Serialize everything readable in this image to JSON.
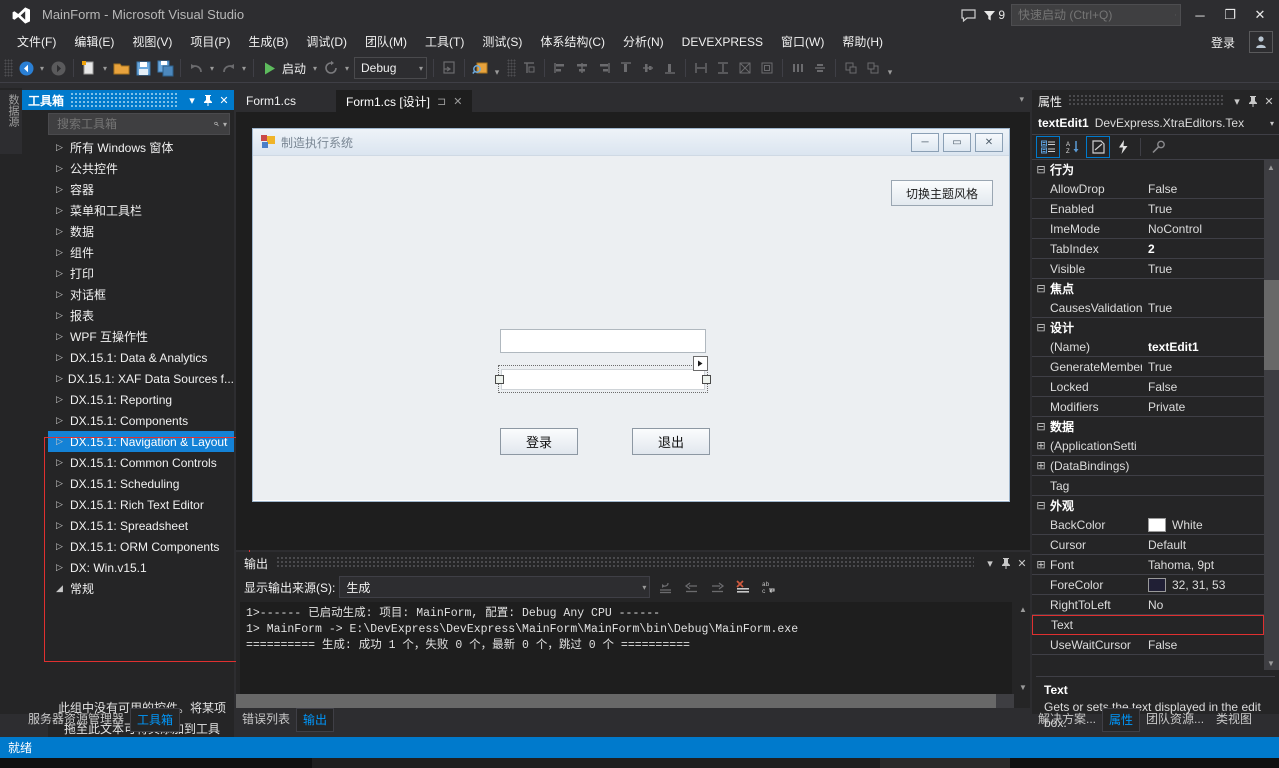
{
  "titlebar": {
    "title": "MainForm - Microsoft Visual Studio",
    "notification_count": "9",
    "quick_launch_placeholder": "快速启动 (Ctrl+Q)",
    "minimize": "─",
    "restore": "❐",
    "close": "✕"
  },
  "menubar": {
    "items": [
      {
        "label": "文件(F)"
      },
      {
        "label": "编辑(E)"
      },
      {
        "label": "视图(V)"
      },
      {
        "label": "项目(P)"
      },
      {
        "label": "生成(B)"
      },
      {
        "label": "调试(D)"
      },
      {
        "label": "团队(M)"
      },
      {
        "label": "工具(T)"
      },
      {
        "label": "测试(S)"
      },
      {
        "label": "体系结构(C)"
      },
      {
        "label": "分析(N)"
      },
      {
        "label": "DEVEXPRESS"
      },
      {
        "label": "窗口(W)"
      },
      {
        "label": "帮助(H)"
      }
    ],
    "signin": "登录"
  },
  "toolbar": {
    "start_label": "启动",
    "configuration": "Debug",
    "overflow": "▾"
  },
  "leftstrip": {
    "vertical_tab": "数据源"
  },
  "toolbox": {
    "title": "工具箱",
    "search_placeholder": "搜索工具箱",
    "items": [
      {
        "label": "所有 Windows 窗体",
        "selected": false
      },
      {
        "label": "公共控件",
        "selected": false
      },
      {
        "label": "容器",
        "selected": false
      },
      {
        "label": "菜单和工具栏",
        "selected": false
      },
      {
        "label": "数据",
        "selected": false
      },
      {
        "label": "组件",
        "selected": false
      },
      {
        "label": "打印",
        "selected": false
      },
      {
        "label": "对话框",
        "selected": false
      },
      {
        "label": "报表",
        "selected": false
      },
      {
        "label": "WPF 互操作性",
        "selected": false
      },
      {
        "label": "DX.15.1: Data & Analytics",
        "selected": false
      },
      {
        "label": "DX.15.1: XAF Data Sources f...",
        "selected": false
      },
      {
        "label": "DX.15.1: Reporting",
        "selected": false
      },
      {
        "label": "DX.15.1: Components",
        "selected": false
      },
      {
        "label": "DX.15.1: Navigation & Layout",
        "selected": true
      },
      {
        "label": "DX.15.1: Common Controls",
        "selected": false
      },
      {
        "label": "DX.15.1: Scheduling",
        "selected": false
      },
      {
        "label": "DX.15.1: Rich Text Editor",
        "selected": false
      },
      {
        "label": "DX.15.1: Spreadsheet",
        "selected": false
      },
      {
        "label": "DX.15.1: ORM Components",
        "selected": false
      },
      {
        "label": "DX: Win.v15.1",
        "selected": false
      },
      {
        "label": "常规",
        "selected": false,
        "expanded": true
      }
    ],
    "empty_note": "此组中没有可用的控件。将某项拖至此文本可将其添加到工具箱。",
    "bottom_tabs": [
      {
        "label": "服务器资源管理器",
        "active": false
      },
      {
        "label": "工具箱",
        "active": true
      }
    ],
    "highlight_color": "#e03030"
  },
  "document_tabs": [
    {
      "label": "Form1.cs",
      "active": false
    },
    {
      "label": "Form1.cs [设计]",
      "active": true
    }
  ],
  "designer": {
    "form_title": "制造执行系统",
    "window_buttons": {
      "minimize": "─",
      "maximize": "▭",
      "close": "✕"
    },
    "theme_button": "切换主题风格",
    "buttons": [
      {
        "label": "登录"
      },
      {
        "label": "退出"
      }
    ],
    "textbox_values": [
      "",
      ""
    ]
  },
  "output": {
    "title": "输出",
    "source_label": "显示输出来源(S):",
    "source_value": "生成",
    "lines": [
      "1>------ 已启动生成:  项目: MainForm, 配置: Debug Any CPU ------",
      "1>  MainForm -> E:\\DevExpress\\DevExpress\\MainForm\\MainForm\\bin\\Debug\\MainForm.exe",
      "========== 生成:  成功 1 个，失败 0 个，最新 0 个，跳过 0 个 =========="
    ],
    "bottom_tabs": [
      {
        "label": "错误列表",
        "active": false
      },
      {
        "label": "输出",
        "active": true
      }
    ]
  },
  "properties": {
    "title": "属性",
    "object_name": "textEdit1",
    "object_type": "DevExpress.XtraEditors.Tex",
    "rows": [
      {
        "kind": "category",
        "key": "行为",
        "expander": "⊟"
      },
      {
        "kind": "prop",
        "key": "AllowDrop",
        "value": "False"
      },
      {
        "kind": "prop",
        "key": "Enabled",
        "value": "True"
      },
      {
        "kind": "prop",
        "key": "ImeMode",
        "value": "NoControl"
      },
      {
        "kind": "prop",
        "key": "TabIndex",
        "value": "2",
        "bold": true
      },
      {
        "kind": "prop",
        "key": "Visible",
        "value": "True"
      },
      {
        "kind": "category",
        "key": "焦点",
        "expander": "⊟"
      },
      {
        "kind": "prop",
        "key": "CausesValidation",
        "value": "True"
      },
      {
        "kind": "category",
        "key": "设计",
        "expander": "⊟"
      },
      {
        "kind": "prop",
        "key": "(Name)",
        "value": "textEdit1",
        "bold": true
      },
      {
        "kind": "prop",
        "key": "GenerateMember",
        "value": "True"
      },
      {
        "kind": "prop",
        "key": "Locked",
        "value": "False"
      },
      {
        "kind": "prop",
        "key": "Modifiers",
        "value": "Private"
      },
      {
        "kind": "category",
        "key": "数据",
        "expander": "⊟"
      },
      {
        "kind": "prop",
        "key": "(ApplicationSetti",
        "value": "",
        "expander": "⊞"
      },
      {
        "kind": "prop",
        "key": "(DataBindings)",
        "value": "",
        "expander": "⊞"
      },
      {
        "kind": "prop",
        "key": "Tag",
        "value": ""
      },
      {
        "kind": "category",
        "key": "外观",
        "expander": "⊟"
      },
      {
        "kind": "prop",
        "key": "BackColor",
        "value": "White",
        "swatch": "#ffffff"
      },
      {
        "kind": "prop",
        "key": "Cursor",
        "value": "Default"
      },
      {
        "kind": "prop",
        "key": "Font",
        "value": "Tahoma, 9pt",
        "expander": "⊞"
      },
      {
        "kind": "prop",
        "key": "ForeColor",
        "value": "32, 31, 53",
        "swatch": "#201f35"
      },
      {
        "kind": "prop",
        "key": "RightToLeft",
        "value": "No"
      },
      {
        "kind": "prop",
        "key": "Text",
        "value": "",
        "selected": true
      },
      {
        "kind": "prop",
        "key": "UseWaitCursor",
        "value": "False"
      }
    ],
    "description": {
      "title": "Text",
      "text": "Gets or sets the text displayed in the edit box."
    },
    "bottom_tabs": [
      {
        "label": "解决方案...",
        "active": false
      },
      {
        "label": "属性",
        "active": true
      },
      {
        "label": "团队资源...",
        "active": false
      },
      {
        "label": "类视图",
        "active": false
      }
    ]
  },
  "statusbar": {
    "text": "就绪",
    "color": "#007acc"
  }
}
